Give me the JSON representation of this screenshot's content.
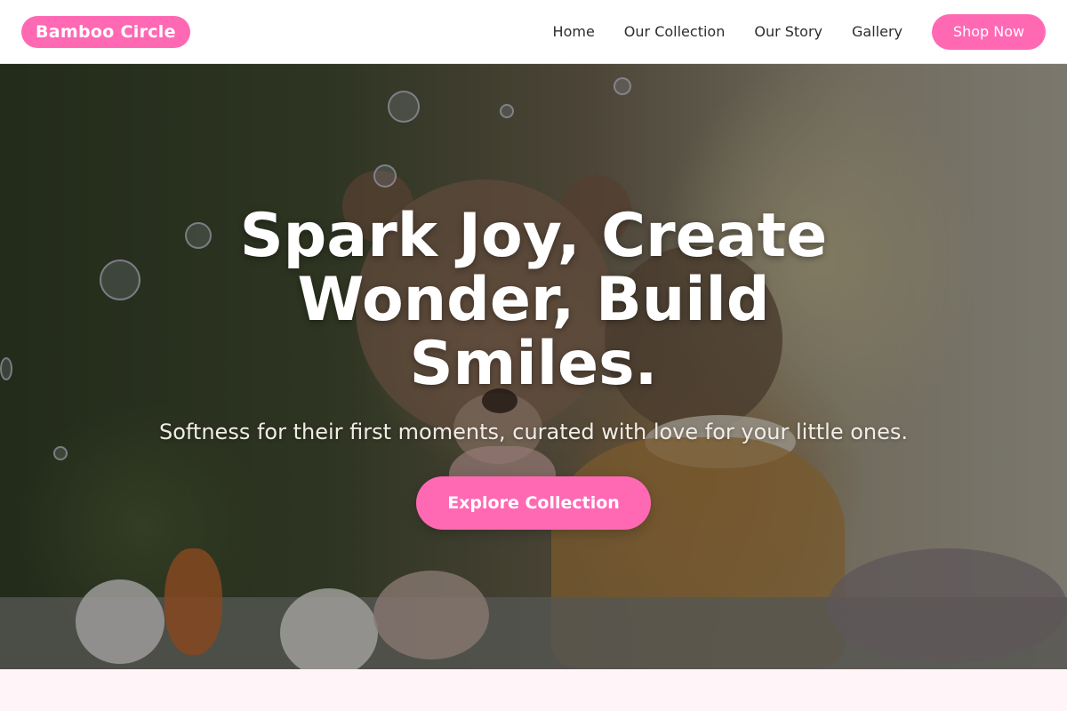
{
  "navbar": {
    "brand": "Bamboo Circle",
    "links": [
      "Home",
      "Our Collection",
      "Our Story",
      "Gallery"
    ],
    "cta": "Shop Now"
  },
  "hero": {
    "title": "Spark Joy, Create Wonder, Build Smiles.",
    "subtitle": "Softness for their first moments, curated with love for your little ones.",
    "button": "Explore Collection",
    "image_description_icon": "baby-with-teddy-bear-photo"
  },
  "colors": {
    "accent": "#ff69b4",
    "nav_background": "#ffffff",
    "section_background": "#fff4f8"
  }
}
